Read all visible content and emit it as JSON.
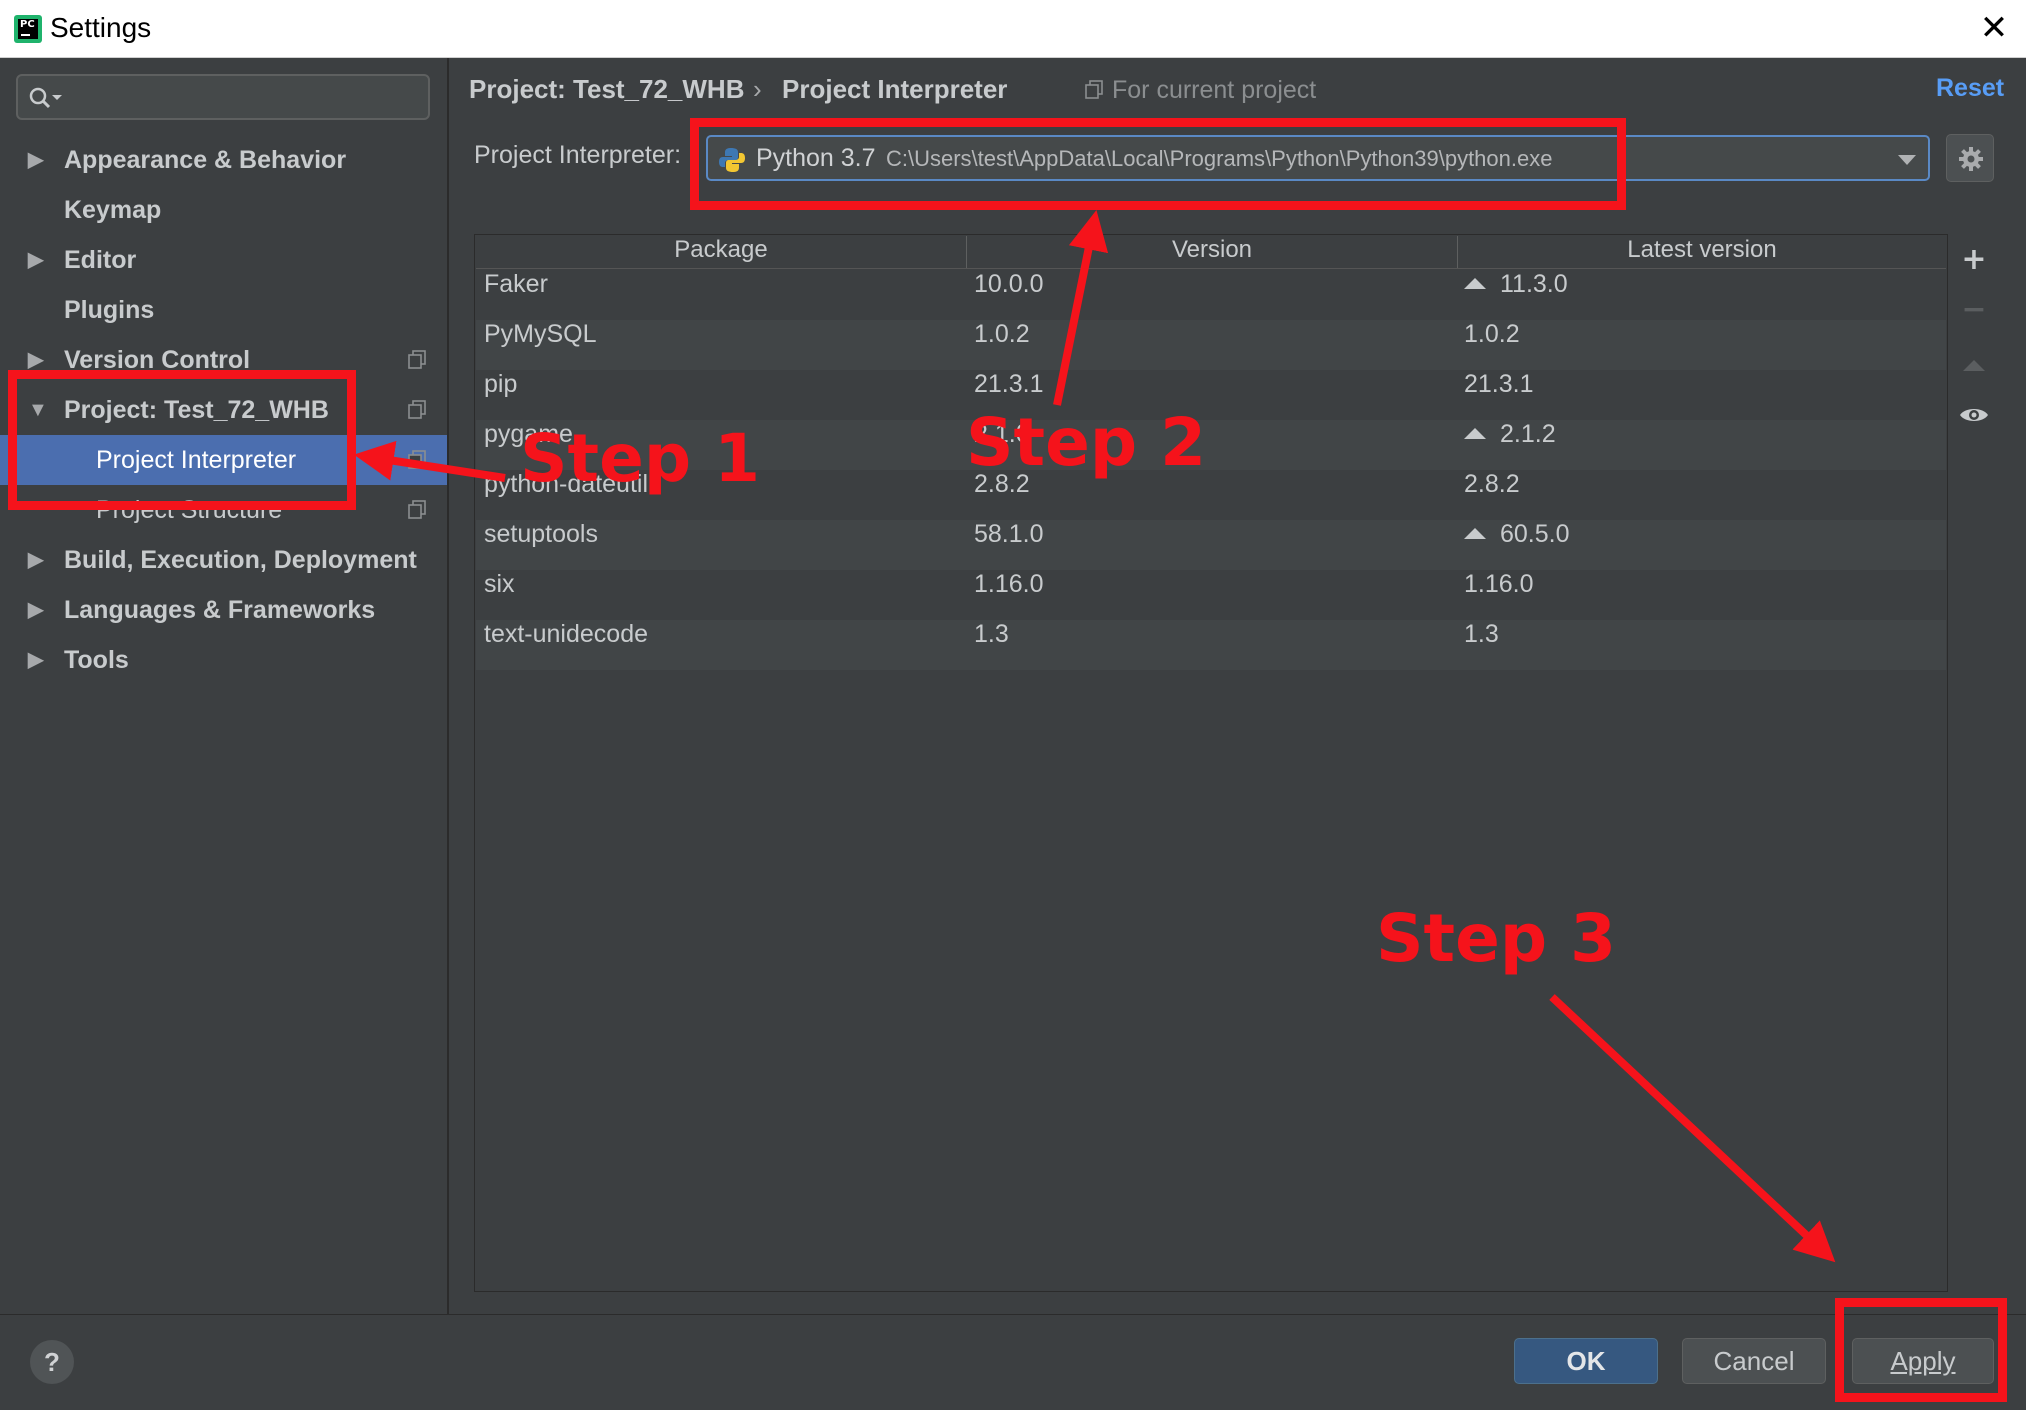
{
  "window": {
    "title": "Settings",
    "close_glyph": "✕"
  },
  "sidebar": {
    "search_placeholder": "",
    "items": [
      {
        "label": "Appearance & Behavior",
        "expandable": true,
        "expanded": false
      },
      {
        "label": "Keymap",
        "expandable": false
      },
      {
        "label": "Editor",
        "expandable": true,
        "expanded": false
      },
      {
        "label": "Plugins",
        "expandable": false
      },
      {
        "label": "Version Control",
        "expandable": true,
        "expanded": false,
        "copy_icon": true
      },
      {
        "label": "Project: Test_72_WHB",
        "expandable": true,
        "expanded": true,
        "copy_icon": true
      },
      {
        "label": "Project Interpreter",
        "child": true,
        "selected": true,
        "copy_icon": true
      },
      {
        "label": "Project Structure",
        "child": true,
        "copy_icon": true
      },
      {
        "label": "Build, Execution, Deployment",
        "expandable": true,
        "expanded": false
      },
      {
        "label": "Languages & Frameworks",
        "expandable": true,
        "expanded": false
      },
      {
        "label": "Tools",
        "expandable": true,
        "expanded": false
      }
    ]
  },
  "header": {
    "breadcrumb_project": "Project: Test_72_WHB",
    "breadcrumb_separator": "›",
    "breadcrumb_page": "Project Interpreter",
    "scope_note": "For current project",
    "reset_label": "Reset"
  },
  "interpreter": {
    "label": "Project Interpreter:",
    "name": "Python 3.7",
    "path": "C:\\Users\\test\\AppData\\Local\\Programs\\Python\\Python39\\python.exe"
  },
  "packages": {
    "columns": [
      "Package",
      "Version",
      "Latest version"
    ],
    "rows": [
      {
        "package": "Faker",
        "version": "10.0.0",
        "latest": "11.3.0",
        "upgrade": true
      },
      {
        "package": "PyMySQL",
        "version": "1.0.2",
        "latest": "1.0.2",
        "upgrade": false
      },
      {
        "package": "pip",
        "version": "21.3.1",
        "latest": "21.3.1",
        "upgrade": false
      },
      {
        "package": "pygame",
        "version": "2.1.0",
        "latest": "2.1.2",
        "upgrade": true
      },
      {
        "package": "python-dateutil",
        "version": "2.8.2",
        "latest": "2.8.2",
        "upgrade": false
      },
      {
        "package": "setuptools",
        "version": "58.1.0",
        "latest": "60.5.0",
        "upgrade": true
      },
      {
        "package": "six",
        "version": "1.16.0",
        "latest": "1.16.0",
        "upgrade": false
      },
      {
        "package": "text-unidecode",
        "version": "1.3",
        "latest": "1.3",
        "upgrade": false
      }
    ],
    "tools": {
      "add": "+",
      "remove": "−"
    }
  },
  "footer": {
    "help": "?",
    "ok_label": "OK",
    "cancel_label": "Cancel",
    "apply_label": "Apply"
  },
  "annotations": {
    "step1": "Step 1",
    "step2": "Step 2",
    "step3": "Step 3",
    "color": "#f5131b"
  },
  "colors": {
    "selection": "#4b6eaf",
    "link": "#589df6",
    "panel": "#3c3f41",
    "ok_button": "#365880"
  }
}
